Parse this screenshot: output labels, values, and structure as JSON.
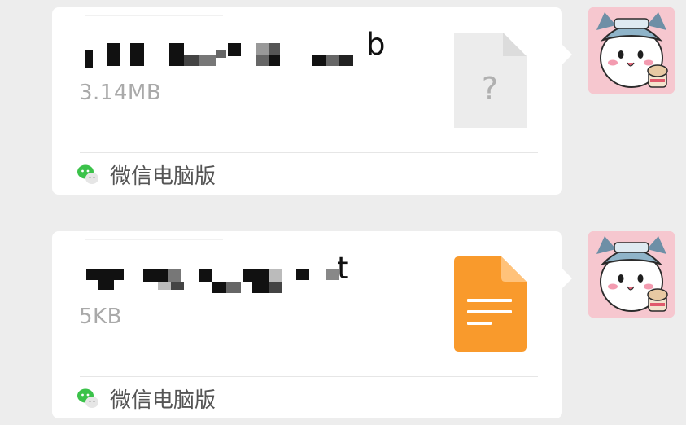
{
  "messages": [
    {
      "file_name_visible_tail": "b",
      "file_size": "3.14MB",
      "file_icon": "unknown-file-icon",
      "file_icon_symbol": "?",
      "source_icon": "wechat-icon",
      "source_label": "微信电脑版",
      "avatar_icon": "cartoon-cat-avatar-icon"
    },
    {
      "file_name_visible_tail": "t",
      "file_size": "5KB",
      "file_icon": "document-file-icon",
      "source_icon": "wechat-icon",
      "source_label": "微信电脑版",
      "avatar_icon": "cartoon-cat-avatar-icon"
    }
  ],
  "colors": {
    "page_background": "#ededed",
    "bubble_background": "#ffffff",
    "file_size_text": "#a9a9a9",
    "source_text": "#555555",
    "doc_icon_orange": "#f99a2c",
    "unknown_icon_gray": "#ececec",
    "wechat_green": "#3bc24a",
    "avatar_pink": "#f6c7cf"
  }
}
